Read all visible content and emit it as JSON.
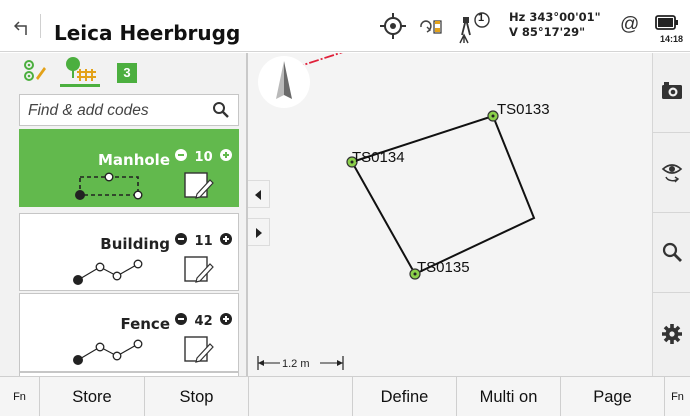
{
  "header": {
    "title": "Leica Heerbrugg",
    "hz": "Hz 343°00'01\"",
    "v": "V  85°17'29\"",
    "at_symbol": "@",
    "time": "14:18",
    "prism_count": "1",
    "icons": [
      "back-arrow-icon",
      "target-icon",
      "rotate-instrument-icon",
      "instrument-face-icon",
      "battery-icon"
    ]
  },
  "codes_panel": {
    "tabs": [
      "point-codes-icon",
      "line-codes-icon"
    ],
    "tab_badge": "3",
    "search_placeholder": "Find & add codes",
    "items": [
      {
        "name": "Manhole",
        "count": "10",
        "active": true,
        "symbol": "manhole-symbol"
      },
      {
        "name": "Building",
        "count": "11",
        "active": false,
        "symbol": "line-symbol"
      },
      {
        "name": "Fence",
        "count": "42",
        "active": false,
        "symbol": "line-symbol"
      }
    ]
  },
  "map": {
    "points": [
      {
        "id": "TS0133"
      },
      {
        "id": "TS0134"
      },
      {
        "id": "TS0135"
      }
    ],
    "scale_label": "1.2 m",
    "accent_color": "#62b94d"
  },
  "right_toolbar": [
    "camera-icon",
    "view-rotate-icon",
    "zoom-icon",
    "settings-icon"
  ],
  "function_keys": [
    {
      "label": "Fn"
    },
    {
      "label": "Store"
    },
    {
      "label": "Stop"
    },
    {
      "label": ""
    },
    {
      "label": "Define"
    },
    {
      "label": "Multi on"
    },
    {
      "label": "Page"
    },
    {
      "label": "Fn"
    }
  ]
}
